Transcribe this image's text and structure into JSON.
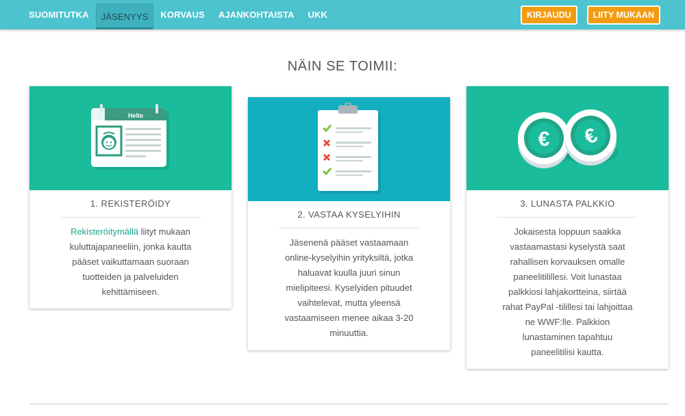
{
  "nav": {
    "items": [
      {
        "label": "SUOMITUTKA",
        "active": false
      },
      {
        "label": "JÄSENYYS",
        "active": true
      },
      {
        "label": "KORVAUS",
        "active": false
      },
      {
        "label": "AJANKOHTAISTA",
        "active": false
      },
      {
        "label": "UKK",
        "active": false
      }
    ],
    "login_label": "KIRJAUDU",
    "join_label": "LIITY MUKAAN"
  },
  "section": {
    "title": "NÄIN SE TOIMII:"
  },
  "cards": [
    {
      "icon": "calendar-profile-icon",
      "badge": "Hello",
      "heading": "1. REKISTERÖIDY",
      "link_text": "Rekisteröitymällä",
      "lines": [
        " liityt mukaan",
        "kuluttajapaneeliin, jonka kautta",
        "pääset vaikuttamaan suoraan",
        "tuotteiden ja palveluiden",
        "kehittämiseen."
      ]
    },
    {
      "icon": "clipboard-checklist-icon",
      "heading": "2. VASTAA KYSELYIHIN",
      "lines": [
        "Jäsenenä pääset vastaamaan",
        "online-kyselyihin yrityksiltä, jotka",
        "haluavat kuulla juuri sinun",
        "mielipiteesi. Kyselyiden pituudet",
        "vaihtelevat, mutta yleensä",
        "vastaamiseen menee aikaa 3-20",
        "minuuttia."
      ]
    },
    {
      "icon": "euro-coins-icon",
      "heading": "3. LUNASTA PALKKIO",
      "lines": [
        "Jokaisesta loppuun saakka",
        "vastaamastasi kyselystä saat",
        "rahallisen korvauksen omalle",
        "paneelitilillesi. Voit lunastaa",
        "palkkiosi lahjakortteina, siirtää",
        "rahat PayPal -tilillesi tai lahjoittaa",
        "ne WWF:lle. Palkkion",
        "lunastaminen tapahtuu",
        "paneelitilisi kautta."
      ]
    }
  ],
  "colors": {
    "navbar": "#4cc3cf",
    "accent_green": "#1abc9c",
    "accent_teal": "#13afc0",
    "button_orange": "#f39c12",
    "link_green": "#14a88b"
  }
}
